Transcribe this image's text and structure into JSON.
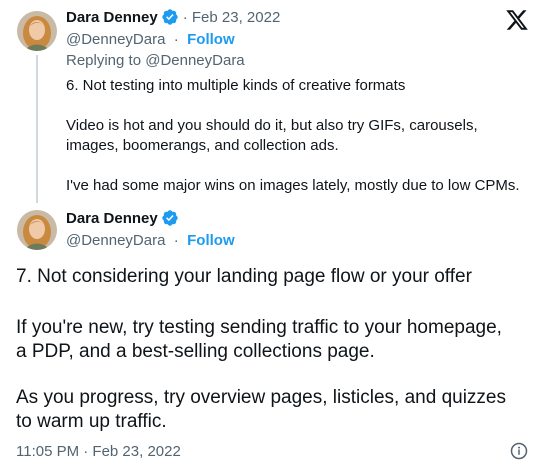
{
  "colors": {
    "accent": "#1d9bf0",
    "secondary_text": "#536471",
    "primary_text": "#0f1419",
    "thread_line": "#cfd9de"
  },
  "header": {
    "logo_icon": "x-logo-icon"
  },
  "quoted_tweet": {
    "display_name": "Dara Denney",
    "verified_icon": "verified-badge-icon",
    "date": "· Feb 23, 2022",
    "handle": "@DenneyDara",
    "separator": "·",
    "follow_label": "Follow",
    "replying_to": "Replying to @DenneyDara",
    "lines": [
      "6. Not testing into multiple kinds of creative formats",
      "Video is hot and you should do it, but also try GIFs, carousels,",
      "images, boomerangs, and collection ads.",
      "I've had some major wins on images lately, mostly due to low CPMs."
    ]
  },
  "main_tweet": {
    "display_name": "Dara Denney",
    "verified_icon": "verified-badge-icon",
    "handle": "@DenneyDara",
    "separator": "·",
    "follow_label": "Follow",
    "lines": [
      "7. Not considering your landing page flow or your offer",
      "If you're new, try testing sending traffic to your homepage,",
      "a PDP, and a best-selling collections page.",
      "As you progress, try overview pages, listicles, and quizzes",
      "to warm up traffic."
    ],
    "timestamp": "11:05 PM · Feb 23, 2022",
    "info_icon": "info-icon"
  }
}
